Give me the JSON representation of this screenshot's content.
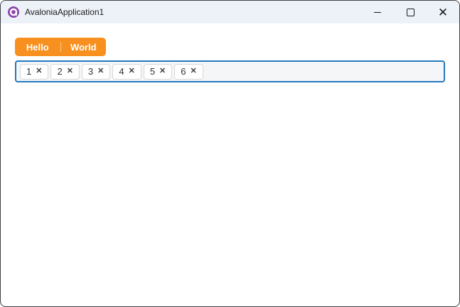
{
  "window": {
    "title": "AvaloniaApplication1"
  },
  "icons": {
    "close_glyph": "✕",
    "logo": "avalonia-logo"
  },
  "tabs": [
    {
      "label": "Hello"
    },
    {
      "label": "World"
    }
  ],
  "chip_input": {
    "remove_glyph": "✕",
    "chips": [
      {
        "value": "1"
      },
      {
        "value": "2"
      },
      {
        "value": "3"
      },
      {
        "value": "4"
      },
      {
        "value": "5"
      },
      {
        "value": "6"
      }
    ]
  },
  "colors": {
    "accent_orange": "#F7901E",
    "focus_border_blue": "#2379BD",
    "titlebar_bg": "#EDF2F9",
    "logo_purple": "#8B44AC",
    "window_border": "#3E4043",
    "chipbox_bg": "#F4F6F8",
    "chip_border": "#D7D7D7"
  }
}
